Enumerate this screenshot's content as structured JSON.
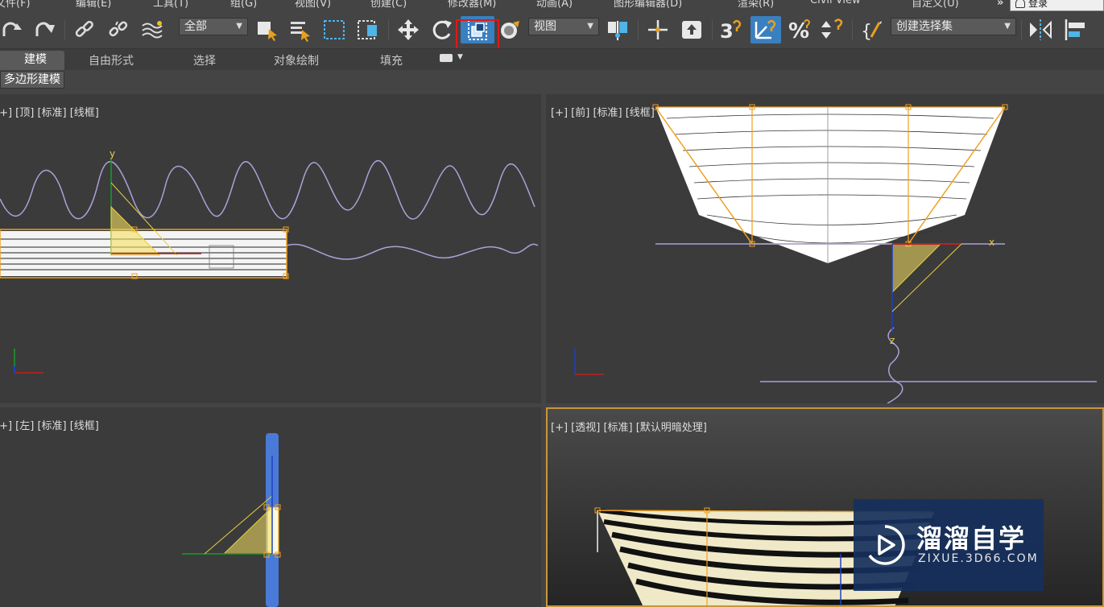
{
  "menubar": {
    "items": [
      "文件(F)",
      "编辑(E)",
      "工具(T)",
      "组(G)",
      "视图(V)",
      "创建(C)",
      "修改器(M)",
      "动画(A)",
      "图形编辑器(D)",
      "渲染(R)",
      "Civil View",
      "自定义(U)"
    ],
    "login": "登录",
    "more": "»"
  },
  "toolbar": {
    "selection_filter": "全部",
    "ref_coord": "视图",
    "named_selection": "创建选择集",
    "snap_labels": [
      "3",
      "2"
    ],
    "highlighted_tool": "select-and-place"
  },
  "ribbon": {
    "tabs": [
      "建模",
      "自由形式",
      "选择",
      "对象绘制",
      "填充"
    ],
    "sub_panel": "多边形建模"
  },
  "viewports": {
    "top": "[+] [顶] [标准] [线框]",
    "front": "[+] [前] [标准] [线框]",
    "left": "[+] [左] [标准] [线框]",
    "perspective": "[+] [透视] [标准] [默认明暗处理]"
  },
  "axes": {
    "x": "x",
    "y": "y",
    "z": "z"
  },
  "watermark": {
    "name": "溜溜自学",
    "url": "ZIXUE.3D66.COM"
  },
  "colors": {
    "ui_bg": "#444444",
    "viewport_bg": "#3b3b3b",
    "selection": "#f0a020",
    "spline": "#a8a2d8",
    "gizmo_fill": "#f5e060",
    "highlight_red": "#e01818",
    "active_blue": "#4a9ad8",
    "watermark_bg": "#16305c"
  }
}
